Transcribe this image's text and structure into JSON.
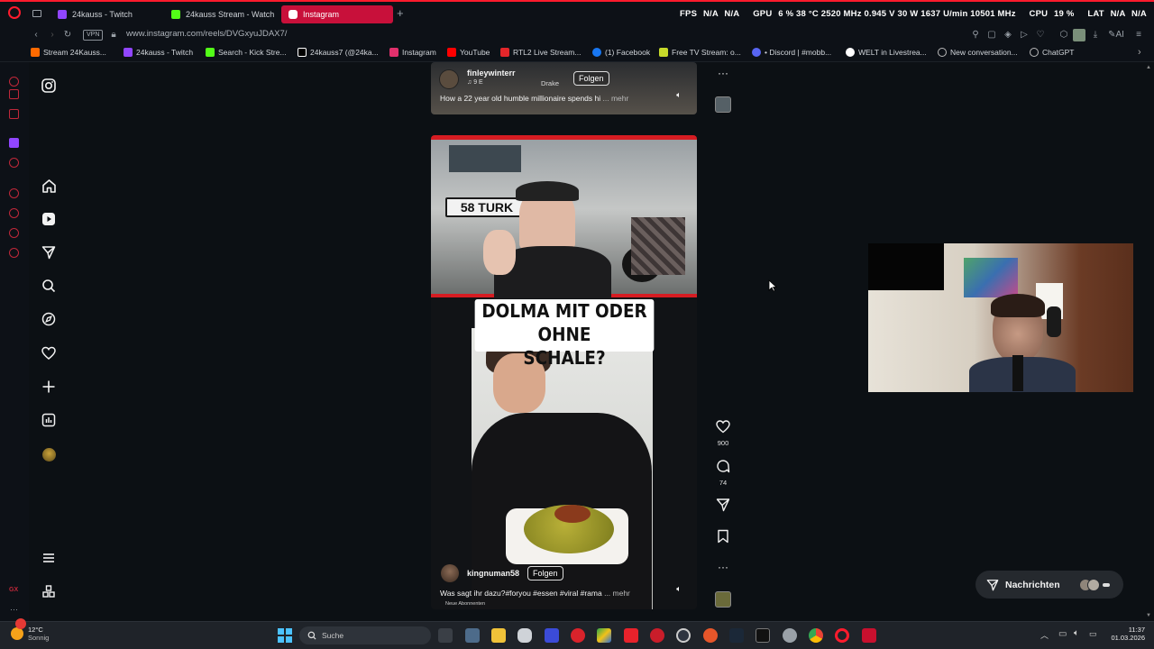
{
  "browser": {
    "tabs": [
      {
        "label": "24kauss - Twitch",
        "color": "#9146ff"
      },
      {
        "label": "24kauss Stream - Watch L",
        "color": "#53fc18"
      },
      {
        "label": "Instagram",
        "color": "#e1306c",
        "active": true
      }
    ],
    "hud": {
      "fps_label": "FPS",
      "fps_value": "N/A",
      "fps_value2": "N/A",
      "gpu_label": "GPU",
      "gpu_value": "6 %  38 °C  2520 MHz  0.945 V  30 W  1637 U/min  10501 MHz",
      "cpu_label": "CPU",
      "cpu_value": "19 %",
      "lat_label": "LAT",
      "lat_value": "N/A",
      "lat_value2": "N/A"
    },
    "vpn_label": "VPN",
    "url": "www.instagram.com/reels/DVGxyuJDAX7/",
    "bookmarks": [
      {
        "label": "Stream 24Kauss...",
        "color": "#ff6a00"
      },
      {
        "label": "24kauss - Twitch",
        "color": "#9146ff"
      },
      {
        "label": "Search - Kick Stre...",
        "color": "#53fc18"
      },
      {
        "label": "24kauss7 (@24ka...",
        "color": "#ffffff"
      },
      {
        "label": "Instagram",
        "color": "#e1306c"
      },
      {
        "label": "YouTube",
        "color": "#ff0000"
      },
      {
        "label": "RTL2 Live Stream...",
        "color": "#e3262a"
      },
      {
        "label": "(1) Facebook",
        "color": "#1877f2"
      },
      {
        "label": "Free TV Stream: o...",
        "color": "#c6d92a"
      },
      {
        "label": "• Discord | #mobb...",
        "color": "#5865f2"
      },
      {
        "label": "WELT in Livestrea...",
        "color": "#ffffff"
      },
      {
        "label": "New conversation...",
        "color": "#bbbbbb"
      },
      {
        "label": "ChatGPT",
        "color": "#bbbbbb"
      }
    ]
  },
  "instagram": {
    "nav": [
      "instagram-logo-icon",
      "home-icon",
      "reels-icon",
      "direct-icon",
      "search-icon",
      "explore-icon",
      "notifications-icon",
      "create-icon",
      "dashboard-icon",
      "profile-avatar",
      "more-menu-icon",
      "also-from-meta-icon"
    ],
    "reel_top": {
      "username": "finleywinterr",
      "audio": "9 E",
      "audio_artist": "Drake",
      "follow": "Folgen",
      "caption": "How a 22 year old humble millionaire spends hi",
      "more": "... mehr"
    },
    "reel_main": {
      "overlay_line1": "DOLMA MIT ODER OHNE",
      "overlay_line2": "SCHALE?",
      "plate_text": "58 TURK",
      "username": "kingnuman58",
      "follow": "Folgen",
      "caption": "Was sagt ihr dazu?#foryou #essen #viral #rama",
      "more": "... mehr",
      "small_label": "Neue Abonnenten"
    },
    "actions": {
      "likes": "900",
      "comments": "74"
    },
    "messages_label": "Nachrichten"
  },
  "taskbar": {
    "weather_temp": "12°C",
    "weather_text": "Sonnig",
    "search_placeholder": "Suche",
    "time": "11:37",
    "date": "01.03.2026"
  },
  "colors": {
    "accent_red": "#ff1b2d",
    "instagram_bg": "#0c1014",
    "browser_bg": "#0d1117"
  }
}
